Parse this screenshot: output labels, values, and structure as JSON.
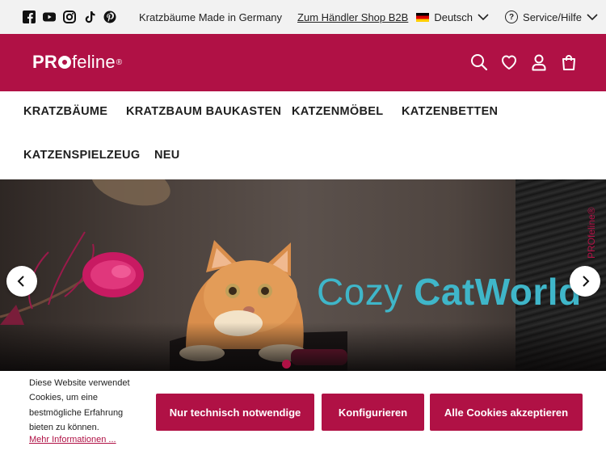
{
  "topbar": {
    "social_icons": [
      "facebook-icon",
      "youtube-icon",
      "instagram-icon",
      "tiktok-icon",
      "pinterest-icon"
    ],
    "tagline": "Kratzbäume Made in Germany",
    "b2b_link": "Zum Händler Shop B2B",
    "language": "Deutsch",
    "service": "Service/Hilfe"
  },
  "header": {
    "logo_pro": "PR",
    "logo_feline": "feline",
    "logo_reg": "®",
    "icons": [
      "search-icon",
      "heart-icon",
      "user-icon",
      "cart-icon"
    ]
  },
  "nav": {
    "items": [
      "KRATZBÄUME",
      "KRATZBAUM BAUKASTEN",
      "KATZENMÖBEL",
      "KATZENBETTEN",
      "KATZENSPIELZEUG",
      "NEU"
    ]
  },
  "hero": {
    "text_light": "Cozy ",
    "text_bold": "CatWorld",
    "side_logo": "PROfeline®",
    "slides_total": 1,
    "active_slide": 1
  },
  "cookie": {
    "text": "Diese Website verwendet Cookies, um eine bestmögliche Erfahrung bieten zu können.",
    "more_link": "Mehr Informationen ...",
    "buttons": {
      "necessary": "Nur technisch notwendige",
      "configure": "Konfigurieren",
      "accept_all": "Alle Cookies akzeptieren"
    }
  },
  "colors": {
    "brand": "#b01145",
    "hero_text": "#3fb6c9",
    "topbar_bg": "#f2f2f2"
  }
}
